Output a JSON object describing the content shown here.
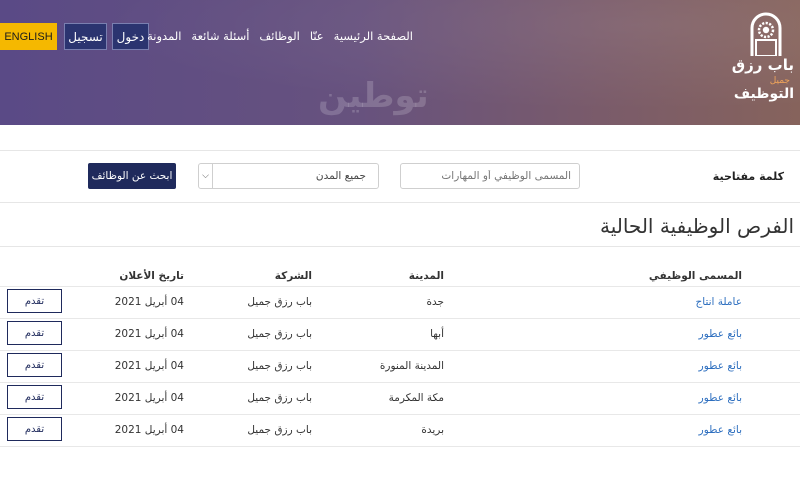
{
  "header": {
    "lang_button": "ENGLISH",
    "register_label": "تسجيل",
    "login_label": "دخول",
    "nav": [
      "الصفحة الرئيسية",
      "عنّا",
      "الوظائف",
      "أسئلة شائعة",
      "المدونة"
    ],
    "brand": {
      "line1": "باب رزق",
      "line2": "جميل",
      "line3": "التوظيف"
    },
    "watermark": "توطين"
  },
  "search": {
    "keyword_label": "كلمة مفتاحية",
    "keyword_placeholder": "المسمى الوظيفي أو المهارات",
    "city_selected": "جميع المدن",
    "search_button": "ابحث عن الوظائف"
  },
  "section": {
    "title": "الفرص الوظيفية الحالية"
  },
  "table": {
    "headers": {
      "title": "المسمى الوظيفي",
      "city": "المدينة",
      "company": "الشركة",
      "date": "تاريخ الأعلان"
    },
    "apply_label": "تقدم",
    "rows": [
      {
        "title": "عاملة انتاج",
        "city": "جدة",
        "company": "باب رزق جميل",
        "date": "04 أبريل 2021"
      },
      {
        "title": "بائع عطور",
        "city": "أبها",
        "company": "باب رزق جميل",
        "date": "04 أبريل 2021"
      },
      {
        "title": "بائع عطور",
        "city": "المدينة المنورة",
        "company": "باب رزق جميل",
        "date": "04 أبريل 2021"
      },
      {
        "title": "بائع عطور",
        "city": "مكة المكرمة",
        "company": "باب رزق جميل",
        "date": "04 أبريل 2021"
      },
      {
        "title": "بائع عطور",
        "city": "بريدة",
        "company": "باب رزق جميل",
        "date": "04 أبريل 2021"
      }
    ]
  },
  "colors": {
    "header_start": "#5a4a86",
    "header_end": "#86635c",
    "accent_yellow": "#f5b800",
    "navy": "#1f2a5c",
    "link_blue": "#2e6fbf"
  }
}
